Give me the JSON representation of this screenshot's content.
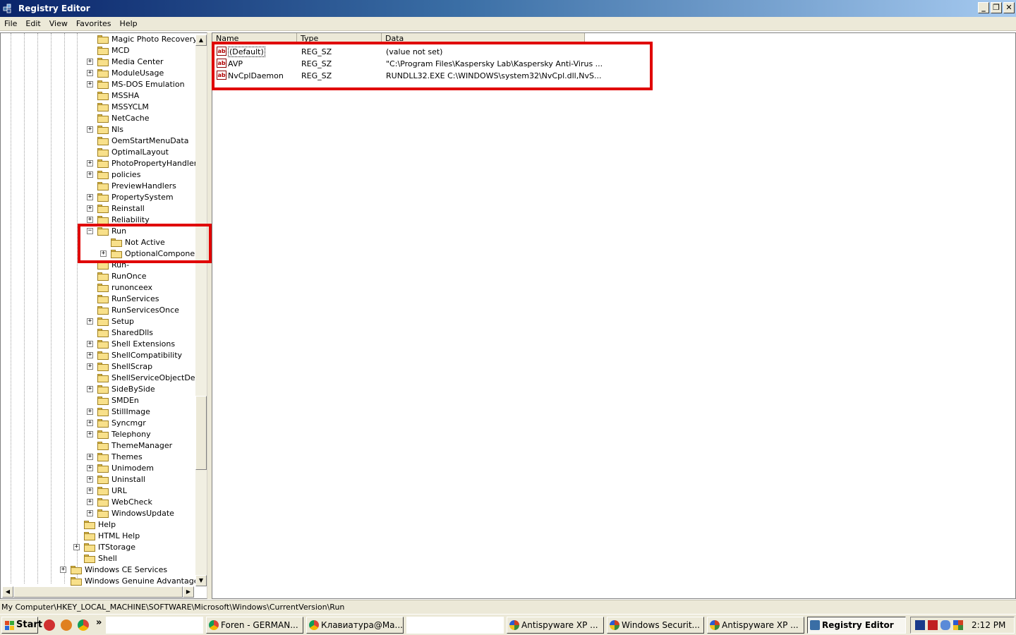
{
  "window": {
    "title": "Registry Editor",
    "controls": {
      "minimize": "_",
      "restore": "❐",
      "close": "✕"
    }
  },
  "menu": [
    "File",
    "Edit",
    "View",
    "Favorites",
    "Help"
  ],
  "tree": {
    "items": [
      {
        "label": "Magic Photo Recovery",
        "depth": 3,
        "expander": "none"
      },
      {
        "label": "MCD",
        "depth": 3,
        "expander": "none"
      },
      {
        "label": "Media Center",
        "depth": 3,
        "expander": "plus"
      },
      {
        "label": "ModuleUsage",
        "depth": 3,
        "expander": "plus"
      },
      {
        "label": "MS-DOS Emulation",
        "depth": 3,
        "expander": "plus"
      },
      {
        "label": "MSSHA",
        "depth": 3,
        "expander": "none"
      },
      {
        "label": "MSSYCLM",
        "depth": 3,
        "expander": "none"
      },
      {
        "label": "NetCache",
        "depth": 3,
        "expander": "none"
      },
      {
        "label": "Nls",
        "depth": 3,
        "expander": "plus"
      },
      {
        "label": "OemStartMenuData",
        "depth": 3,
        "expander": "none"
      },
      {
        "label": "OptimalLayout",
        "depth": 3,
        "expander": "none"
      },
      {
        "label": "PhotoPropertyHandler",
        "depth": 3,
        "expander": "plus"
      },
      {
        "label": "policies",
        "depth": 3,
        "expander": "plus"
      },
      {
        "label": "PreviewHandlers",
        "depth": 3,
        "expander": "none"
      },
      {
        "label": "PropertySystem",
        "depth": 3,
        "expander": "plus"
      },
      {
        "label": "Reinstall",
        "depth": 3,
        "expander": "plus"
      },
      {
        "label": "Reliability",
        "depth": 3,
        "expander": "plus"
      },
      {
        "label": "Run",
        "depth": 3,
        "expander": "minus",
        "open": true
      },
      {
        "label": "Not Active",
        "depth": 4,
        "expander": "none"
      },
      {
        "label": "OptionalComponents",
        "depth": 4,
        "expander": "plus"
      },
      {
        "label": "Run-",
        "depth": 3,
        "expander": "none"
      },
      {
        "label": "RunOnce",
        "depth": 3,
        "expander": "none"
      },
      {
        "label": "runonceex",
        "depth": 3,
        "expander": "none"
      },
      {
        "label": "RunServices",
        "depth": 3,
        "expander": "none"
      },
      {
        "label": "RunServicesOnce",
        "depth": 3,
        "expander": "none"
      },
      {
        "label": "Setup",
        "depth": 3,
        "expander": "plus"
      },
      {
        "label": "SharedDlls",
        "depth": 3,
        "expander": "none"
      },
      {
        "label": "Shell Extensions",
        "depth": 3,
        "expander": "plus"
      },
      {
        "label": "ShellCompatibility",
        "depth": 3,
        "expander": "plus"
      },
      {
        "label": "ShellScrap",
        "depth": 3,
        "expander": "plus"
      },
      {
        "label": "ShellServiceObjectDelayl",
        "depth": 3,
        "expander": "none"
      },
      {
        "label": "SideBySide",
        "depth": 3,
        "expander": "plus"
      },
      {
        "label": "SMDEn",
        "depth": 3,
        "expander": "none"
      },
      {
        "label": "StillImage",
        "depth": 3,
        "expander": "plus"
      },
      {
        "label": "Syncmgr",
        "depth": 3,
        "expander": "plus"
      },
      {
        "label": "Telephony",
        "depth": 3,
        "expander": "plus"
      },
      {
        "label": "ThemeManager",
        "depth": 3,
        "expander": "none"
      },
      {
        "label": "Themes",
        "depth": 3,
        "expander": "plus"
      },
      {
        "label": "Unimodem",
        "depth": 3,
        "expander": "plus"
      },
      {
        "label": "Uninstall",
        "depth": 3,
        "expander": "plus"
      },
      {
        "label": "URL",
        "depth": 3,
        "expander": "plus"
      },
      {
        "label": "WebCheck",
        "depth": 3,
        "expander": "plus"
      },
      {
        "label": "WindowsUpdate",
        "depth": 3,
        "expander": "plus"
      },
      {
        "label": "Help",
        "depth": 2,
        "expander": "none"
      },
      {
        "label": "HTML Help",
        "depth": 2,
        "expander": "none"
      },
      {
        "label": "ITStorage",
        "depth": 2,
        "expander": "plus"
      },
      {
        "label": "Shell",
        "depth": 2,
        "expander": "none"
      },
      {
        "label": "Windows CE Services",
        "depth": 1,
        "expander": "plus"
      },
      {
        "label": "Windows Genuine Advantage",
        "depth": 1,
        "expander": "none"
      }
    ],
    "scroll_up": "▲",
    "scroll_down": "▼",
    "scroll_left": "◀",
    "scroll_right": "▶"
  },
  "values": {
    "columns": [
      "Name",
      "Type",
      "Data"
    ],
    "rows": [
      {
        "name": "(Default)",
        "type": "REG_SZ",
        "data": "(value not set)",
        "icon": "ab"
      },
      {
        "name": "AVP",
        "type": "REG_SZ",
        "data": "\"C:\\Program Files\\Kaspersky Lab\\Kaspersky Anti-Virus ...",
        "icon": "ab"
      },
      {
        "name": "NvCplDaemon",
        "type": "REG_SZ",
        "data": "RUNDLL32.EXE C:\\WINDOWS\\system32\\NvCpl.dll,NvS...",
        "icon": "ab"
      }
    ]
  },
  "status": {
    "path": "My Computer\\HKEY_LOCAL_MACHINE\\SOFTWARE\\Microsoft\\Windows\\CurrentVersion\\Run"
  },
  "taskbar": {
    "start_label": "Start",
    "quicklaunch_more": "»",
    "tasks": [
      {
        "label": "Foren - GERMAN...",
        "icon_color": "#2a8a2a",
        "active": false
      },
      {
        "label": "Клавиатура@Ма...",
        "icon_color": "#2a8a2a",
        "active": false
      },
      {
        "label": "Antispyware XP ...",
        "icon_color": "#d04020",
        "active": false
      },
      {
        "label": "Windows Securit...",
        "icon_color": "#d04020",
        "active": false
      },
      {
        "label": "Antispyware XP ...",
        "icon_color": "#d04020",
        "active": false
      },
      {
        "label": "Registry Editor",
        "icon_color": "#3a6ea5",
        "active": true
      }
    ],
    "tray_icons": [
      "ff-tray-icon",
      "ffu-tray-icon",
      "chat-tray-icon",
      "shield-tray-icon"
    ],
    "clock": "2:12 PM"
  },
  "colors": {
    "highlight": "#e00000",
    "titlebar_start": "#0a246a",
    "titlebar_end": "#a6caf0"
  }
}
